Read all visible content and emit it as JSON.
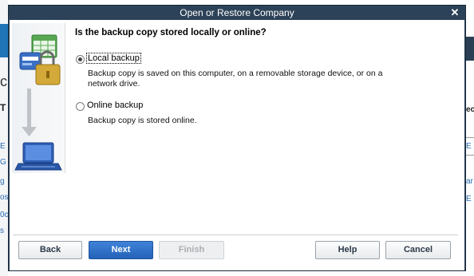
{
  "dialog": {
    "title": "Open or Restore Company",
    "question": "Is the backup copy stored locally or online?",
    "options": [
      {
        "label": "Local backup",
        "underline_char": "L",
        "description_lines": [
          "Backup copy is saved on this computer, on a removable storage device, or on a",
          "network drive."
        ],
        "selected": true
      },
      {
        "label": "Online backup",
        "underline_char": "O",
        "description_lines": [
          "Backup copy is stored online."
        ],
        "selected": false
      }
    ],
    "buttons": {
      "back": "Back",
      "next": "Next",
      "finish": "Finish",
      "help": "Help",
      "cancel": "Cancel"
    },
    "accent_color": "#2c4258",
    "primary_button_color": "#2462b8"
  },
  "background_fragments": {
    "left": [
      "c",
      "T",
      "E",
      "G",
      "g",
      "os",
      "0c",
      "s"
    ],
    "right": [
      "ec",
      "E",
      "ar",
      "E"
    ]
  }
}
